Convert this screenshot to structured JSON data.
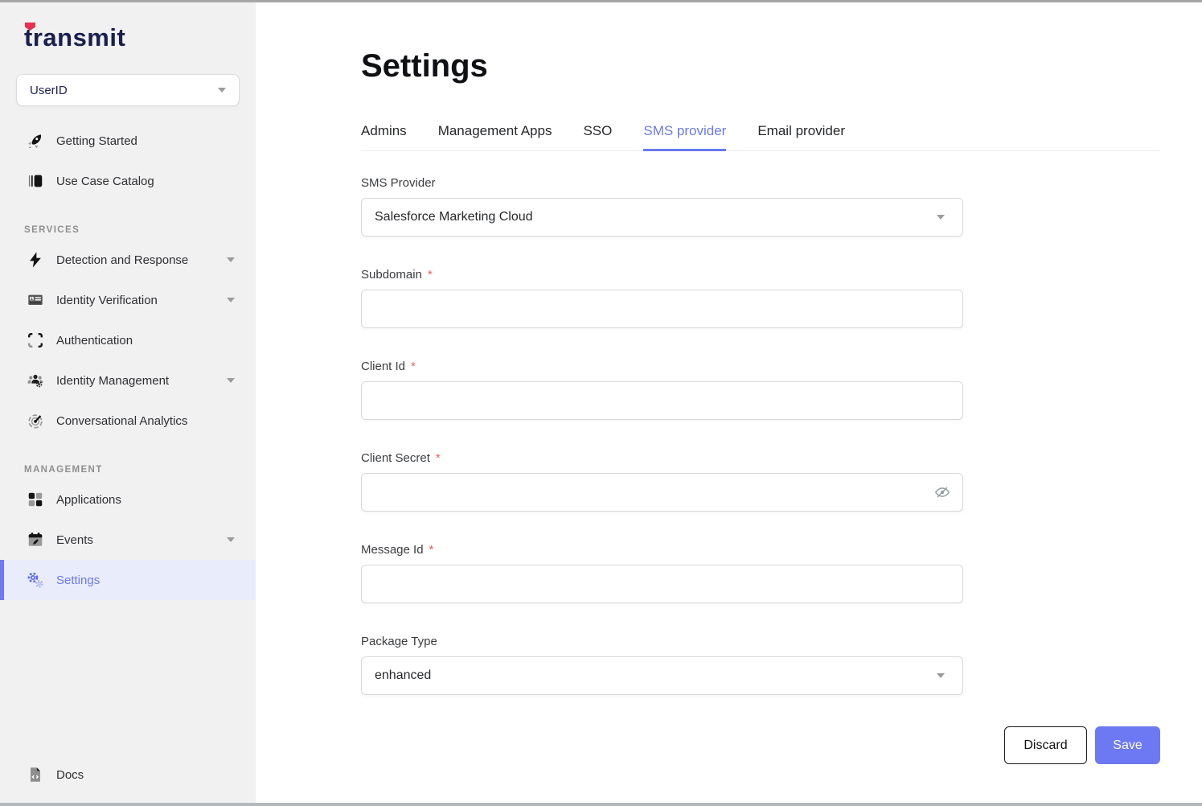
{
  "colors": {
    "accent": "#6d79f2",
    "active_item_bg": "#e9ecfb",
    "required_marker_color": "#f25d5d",
    "sidebar_bg": "#f1f1f1",
    "logo_navy": "#191f4e",
    "logo_red": "#e83152"
  },
  "sidebar": {
    "logo_text": "transmit",
    "workspace": {
      "value": "UserID"
    },
    "top_items": [
      {
        "label": "Getting Started",
        "icon": "rocket-icon"
      },
      {
        "label": "Use Case Catalog",
        "icon": "catalog-icon"
      }
    ],
    "sections": [
      {
        "title": "SERVICES",
        "items": [
          {
            "label": "Detection and Response",
            "icon": "lightning-icon",
            "expandable": true
          },
          {
            "label": "Identity Verification",
            "icon": "id-card-icon",
            "expandable": true
          },
          {
            "label": "Authentication",
            "icon": "scan-frame-icon",
            "expandable": false
          },
          {
            "label": "Identity Management",
            "icon": "users-gear-icon",
            "expandable": true
          },
          {
            "label": "Conversational Analytics",
            "icon": "gauge-icon",
            "expandable": false
          }
        ]
      },
      {
        "title": "MANAGEMENT",
        "items": [
          {
            "label": "Applications",
            "icon": "app-grid-icon",
            "expandable": false
          },
          {
            "label": "Events",
            "icon": "calendar-edit-icon",
            "expandable": true
          },
          {
            "label": "Settings",
            "icon": "gears-icon",
            "expandable": false,
            "active": true
          }
        ]
      }
    ],
    "footer_item": {
      "label": "Docs",
      "icon": "doc-code-icon"
    }
  },
  "main": {
    "title": "Settings",
    "tabs": [
      {
        "label": "Admins",
        "active": false
      },
      {
        "label": "Management Apps",
        "active": false
      },
      {
        "label": "SSO",
        "active": false
      },
      {
        "label": "SMS provider",
        "active": true
      },
      {
        "label": "Email provider",
        "active": false
      }
    ],
    "form": {
      "required_marker": "*",
      "fields": [
        {
          "label": "SMS Provider",
          "required": false,
          "type": "select",
          "value": "Salesforce Marketing Cloud"
        },
        {
          "label": "Subdomain",
          "required": true,
          "type": "text",
          "value": ""
        },
        {
          "label": "Client Id",
          "required": true,
          "type": "text",
          "value": ""
        },
        {
          "label": "Client Secret",
          "required": true,
          "type": "password",
          "value": "",
          "trailing_icon": "eye-off-icon"
        },
        {
          "label": "Message Id",
          "required": true,
          "type": "text",
          "value": ""
        },
        {
          "label": "Package Type",
          "required": false,
          "type": "select",
          "value": "enhanced"
        }
      ]
    },
    "actions": {
      "discard_label": "Discard",
      "save_label": "Save"
    }
  }
}
